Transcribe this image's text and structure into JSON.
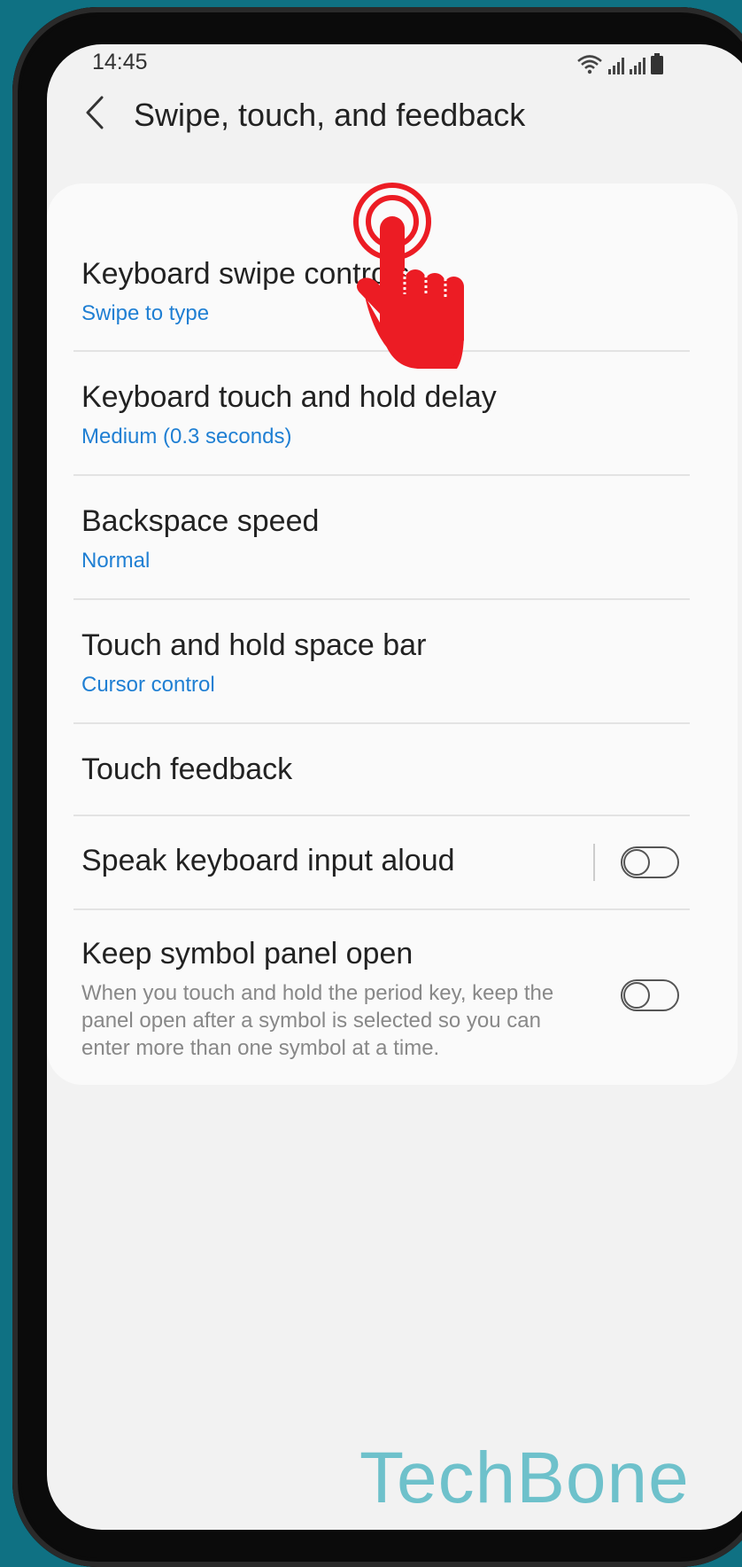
{
  "status_bar": {
    "time": "14:45"
  },
  "header": {
    "title": "Swipe, touch, and feedback"
  },
  "settings": [
    {
      "title": "Keyboard swipe controls",
      "subtitle": "Swipe to type"
    },
    {
      "title": "Keyboard touch and hold delay",
      "subtitle": "Medium (0.3 seconds)"
    },
    {
      "title": "Backspace speed",
      "subtitle": "Normal"
    },
    {
      "title": "Touch and hold space bar",
      "subtitle": "Cursor control"
    },
    {
      "title": "Touch feedback"
    },
    {
      "title": "Speak keyboard input aloud",
      "toggle": "off"
    },
    {
      "title": "Keep symbol panel open",
      "description": "When you touch and hold the period key, keep the panel open after a symbol is selected so you can enter more than one symbol at a time.",
      "toggle": "off"
    }
  ],
  "watermark": "TechBone",
  "colors": {
    "background": "#0f7183",
    "accent": "#1f7fd3",
    "tap_indicator": "#ec1c24",
    "watermark": "#6ec1cb"
  },
  "icons": {
    "back": "chevron-left-icon",
    "wifi": "wifi-icon",
    "signal": "signal-bars-icon",
    "battery": "battery-icon",
    "tap": "tap-hand-icon"
  }
}
